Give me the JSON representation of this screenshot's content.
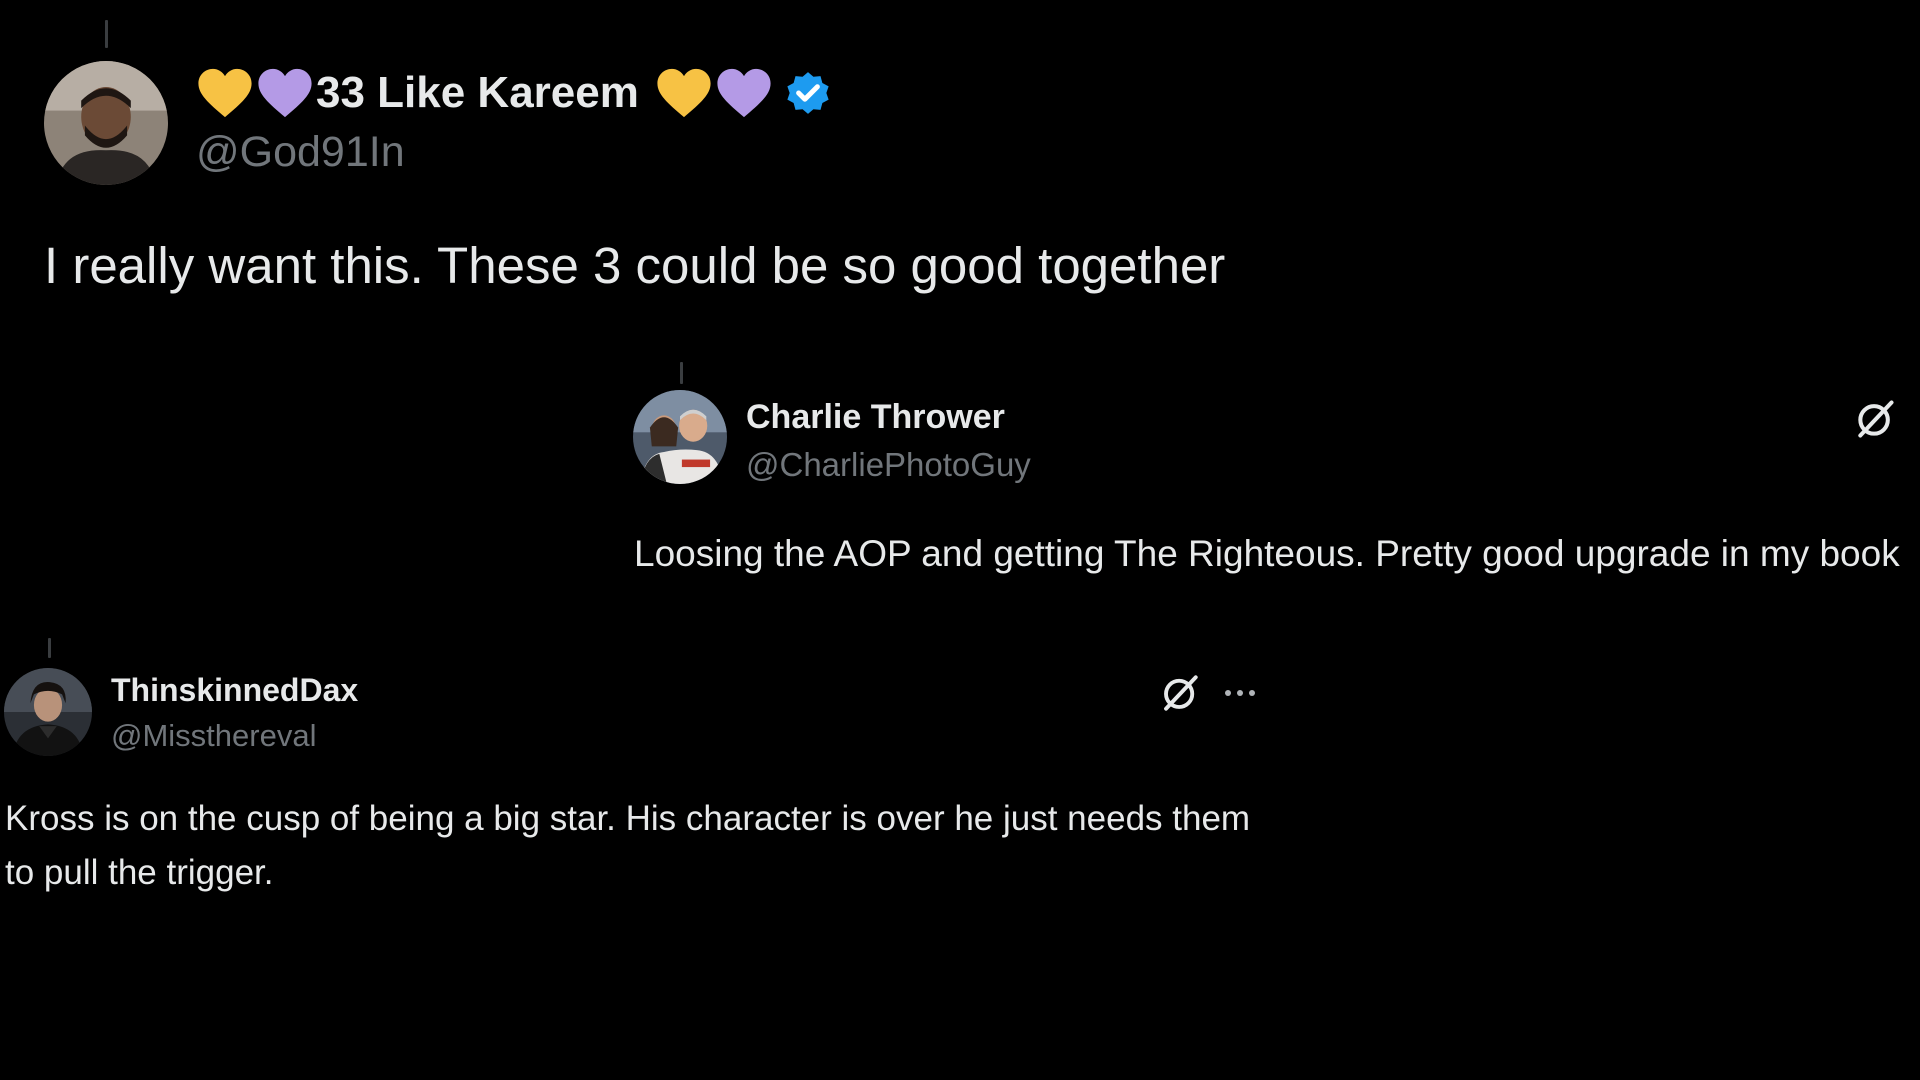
{
  "tweets": [
    {
      "display_name": "33 Like Kareem",
      "name_prefix_icons": [
        "yellow-heart",
        "purple-heart"
      ],
      "name_suffix_icons": [
        "yellow-heart",
        "purple-heart"
      ],
      "verified": true,
      "handle": "@God91In",
      "text": "I really want this. These 3 could be so good together",
      "avatar": "profile-photo-man"
    },
    {
      "display_name": "Charlie Thrower",
      "verified": false,
      "handle": "@CharliePhotoGuy",
      "text": "Loosing the AOP and getting The Righteous. Pretty good upgrade in my book",
      "avatar": "profile-photo-couple",
      "actions": [
        "grok-icon"
      ]
    },
    {
      "display_name": "ThinskinnedDax",
      "verified": false,
      "handle": "@Missthereval",
      "text": "Kross is on the cusp of being a big star. His character is over he just needs them to pull the trigger.",
      "avatar": "profile-photo-person",
      "actions": [
        "grok-icon",
        "more-options-icon"
      ]
    }
  ],
  "colors": {
    "background": "#000000",
    "text_primary": "#e7e9ea",
    "text_secondary": "#71767b",
    "verified_blue": "#1d9bf0",
    "heart_yellow": "#f7c244",
    "heart_purple": "#b49ae6"
  }
}
